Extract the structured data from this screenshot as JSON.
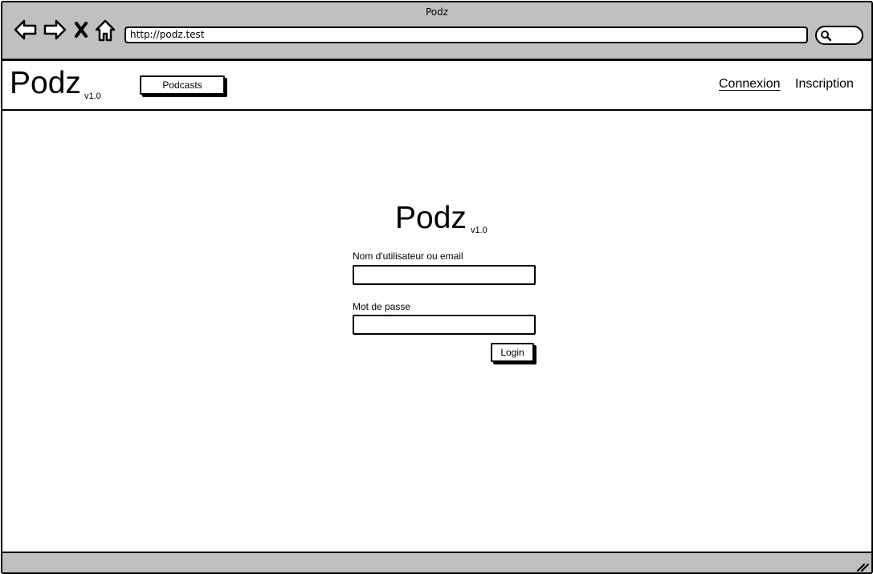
{
  "browser": {
    "window_title": "Podz",
    "url": "http://podz.test",
    "icons": [
      "back-arrow-icon",
      "forward-arrow-icon",
      "stop-icon",
      "home-icon",
      "search-icon",
      "resize-grip-icon"
    ]
  },
  "header": {
    "brand": "Podz",
    "version": "v1.0",
    "podcasts_button": "Podcasts",
    "nav": {
      "login": "Connexion",
      "register": "Inscription"
    }
  },
  "login_form": {
    "brand": "Podz",
    "version": "v1.0",
    "username_label": "Nom d'utilisateur ou email",
    "username_value": "",
    "password_label": "Mot de passe",
    "password_value": "",
    "submit_label": "Login"
  },
  "colors": {
    "chrome_gray": "#c0c0c0",
    "stroke": "#000000",
    "background": "#ffffff"
  }
}
